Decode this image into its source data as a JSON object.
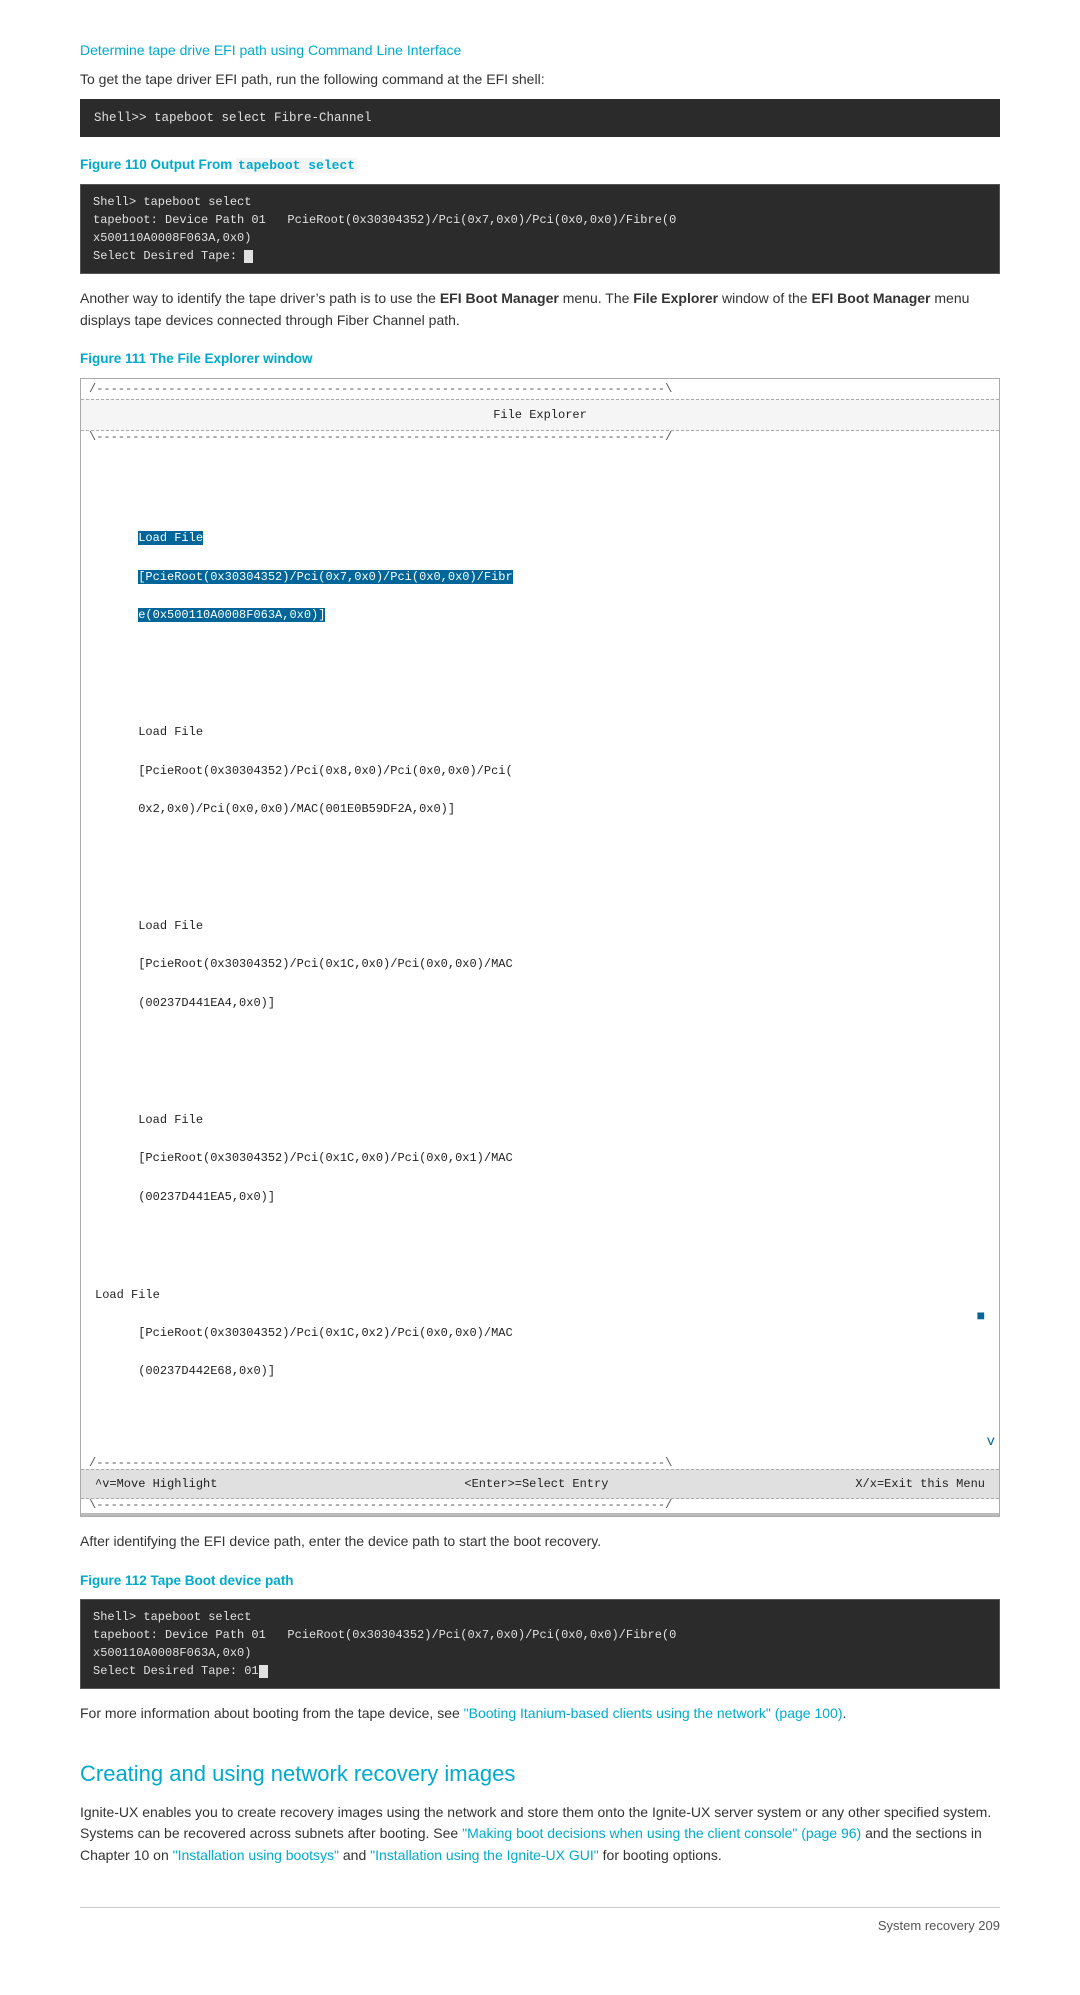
{
  "page": {
    "footer": "System recovery   209"
  },
  "section_link": {
    "label": "Determine tape drive EFI path using Command Line Interface"
  },
  "intro_text": {
    "line1": "To get the tape driver EFI path, run the following command at the EFI shell:",
    "command": "Shell>> tapeboot select Fibre-Channel"
  },
  "figure110": {
    "heading": "Figure 110 Output From",
    "heading_code": "tapeboot select",
    "terminal": {
      "line1": "Shell> tapeboot select",
      "line2": "tapeboot: Device Path 01   PcieRoot(0x30304352)/Pci(0x7,0x0)/Pci(0x0,0x0)/Fibre(0",
      "line3": "x500110A0008F063A,0x0)",
      "line4": "Select Desired Tape: "
    }
  },
  "paragraph1": {
    "text_before": "Another way to identify the tape driver’s path is to use the ",
    "bold1": "EFI Boot Manager",
    "text_mid": " menu. The ",
    "bold2": "File Explorer",
    "text_after": " window of the ",
    "bold3": "EFI Boot Manager",
    "text_end": " menu displays tape devices connected through Fiber Channel path."
  },
  "figure111": {
    "heading": "Figure 111 The File Explorer window",
    "file_explorer": {
      "title": "File Explorer",
      "entries": [
        {
          "label": "Load File",
          "path": "[PcieRoot(0x30304352)/Pci(0x7,0x0)/Pci(0x0,0x0)/Fibr",
          "path2": "e(0x500110A0008F063A,0x0)]",
          "highlighted": true
        },
        {
          "label": "Load File",
          "path": "[PcieRoot(0x30304352)/Pci(0x8,0x0)/Pci(0x0,0x0)/Pci(",
          "path2": "0x2,0x0)/Pci(0x0,0x0)/MAC(001E0B59DF2A,0x0)]",
          "highlighted": false
        },
        {
          "label": "Load File",
          "path": "[PcieRoot(0x30304352)/Pci(0x1C,0x0)/Pci(0x0,0x0)/MAC",
          "path2": "(00237D441EA4,0x0)]",
          "highlighted": false
        },
        {
          "label": "Load File",
          "path": "[PcieRoot(0x30304352)/Pci(0x1C,0x0)/Pci(0x0,0x1)/MAC",
          "path2": "(00237D441EA5,0x0)]",
          "highlighted": false
        },
        {
          "label": "Load File",
          "path": "[PcieRoot(0x30304352)/Pci(0x1C,0x2)/Pci(0x0,0x0)/MAC",
          "path2": "(00237D442E68,0x0)]",
          "highlighted": false
        }
      ],
      "scrollbar_char": "v",
      "footer_left": "^v=Move Highlight",
      "footer_mid": "<Enter>=Select Entry",
      "footer_right": "X/x=Exit this Menu"
    }
  },
  "paragraph2": {
    "text": "After identifying the EFI device path, enter the device path to start the boot recovery."
  },
  "figure112": {
    "heading": "Figure 112  Tape Boot device path",
    "terminal": {
      "line1": "Shell> tapeboot select",
      "line2": "tapeboot: Device Path 01   PcieRoot(0x30304352)/Pci(0x7,0x0)/Pci(0x0,0x0)/Fibre(0",
      "line3": "x500110A0008F063A,0x0)",
      "line4": "Select Desired Tape: 01"
    }
  },
  "paragraph3": {
    "text_before": "For more information about booting from the tape device, see ",
    "link": "\"Booting Itanium-based clients using the network\" (page 100)",
    "text_after": "."
  },
  "section_creating": {
    "title": "Creating and using network recovery images",
    "body": {
      "text1": "Ignite-UX enables you to create recovery images using the network and store them onto the Ignite-UX server system or any other specified system. Systems can be recovered across subnets after booting. See ",
      "link1": "\"Making boot decisions when using the client console\" (page 96)",
      "text2": " and the sections in Chapter 10 on ",
      "link2": "\"Installation using bootsys\"",
      "text3": " and ",
      "link3": "\"Installation using the Ignite-UX GUI\"",
      "text4": " for booting options."
    }
  }
}
